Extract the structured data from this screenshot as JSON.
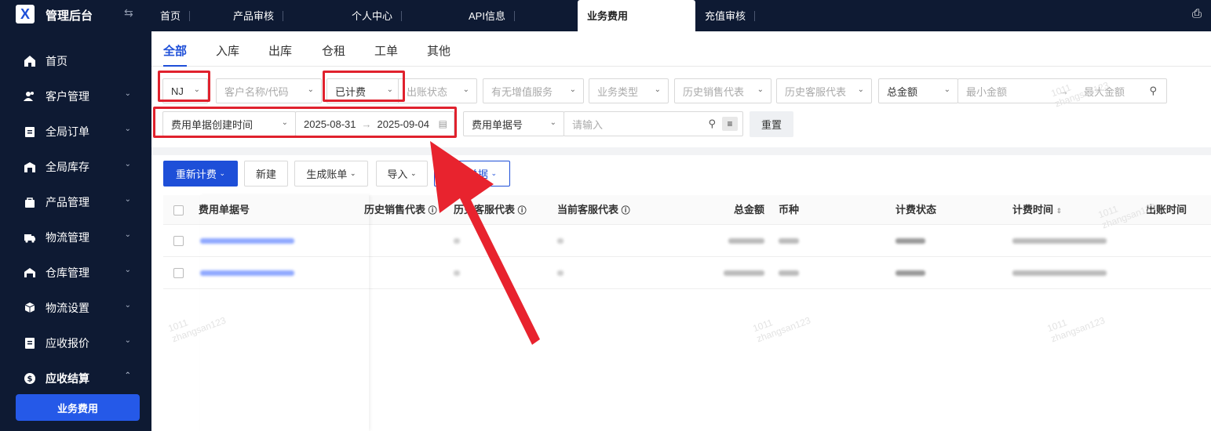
{
  "app": {
    "title": "管理后台",
    "logo_letter": "X"
  },
  "sidebar": {
    "items": [
      {
        "label": "首页",
        "icon": "home-icon",
        "expandable": false
      },
      {
        "label": "客户管理",
        "icon": "users-icon",
        "expandable": true
      },
      {
        "label": "全局订单",
        "icon": "clipboard-icon",
        "expandable": true
      },
      {
        "label": "全局库存",
        "icon": "warehouse-icon",
        "expandable": true
      },
      {
        "label": "产品管理",
        "icon": "bag-icon",
        "expandable": true
      },
      {
        "label": "物流管理",
        "icon": "truck-icon",
        "expandable": true
      },
      {
        "label": "仓库管理",
        "icon": "storehouse-icon",
        "expandable": true
      },
      {
        "label": "物流设置",
        "icon": "boxes-icon",
        "expandable": true
      },
      {
        "label": "应收报价",
        "icon": "document-icon",
        "expandable": true
      },
      {
        "label": "应收结算",
        "icon": "dollar-icon",
        "expandable": true,
        "open": true
      }
    ],
    "active_sub": "业务费用"
  },
  "top_tabs": [
    "首页",
    "产品审核",
    "个人中心",
    "API信息",
    "业务费用",
    "充值审核"
  ],
  "active_top_tab": "业务费用",
  "sub_tabs": [
    "全部",
    "入库",
    "出库",
    "仓租",
    "工单",
    "其他"
  ],
  "active_sub_tab": "全部",
  "filters": {
    "warehouse": "NJ",
    "customer_placeholder": "客户名称/代码",
    "billing_status": "已计费",
    "bill_status_placeholder": "出账状态",
    "vas_placeholder": "有无增值服务",
    "biz_type_placeholder": "业务类型",
    "hist_sales_placeholder": "历史销售代表",
    "hist_cs_placeholder": "历史客服代表",
    "amount_field": "总金额",
    "min_amount_placeholder": "最小金额",
    "max_amount_placeholder": "最大金额",
    "date_field": "费用单据创建时间",
    "date_start": "2025-08-31",
    "date_end": "2025-09-04",
    "doc_field": "费用单据号",
    "doc_placeholder": "请输入",
    "reset_label": "重置"
  },
  "actions": {
    "recalc": "重新计费",
    "create": "新建",
    "gen_bill": "生成账单",
    "import": "导入",
    "export": "导出单据"
  },
  "table": {
    "headers": [
      "费用单据号",
      "历史销售代表",
      "历史客服代表",
      "当前客服代表",
      "总金额",
      "币种",
      "计费状态",
      "计费时间",
      "出账时间"
    ],
    "rows_count": 2
  },
  "watermark": {
    "id": "1011",
    "user": "zhangsan123"
  },
  "colors": {
    "sidebar_bg": "#0e1a33",
    "accent": "#1e4fd8",
    "highlight": "#e0212d"
  }
}
